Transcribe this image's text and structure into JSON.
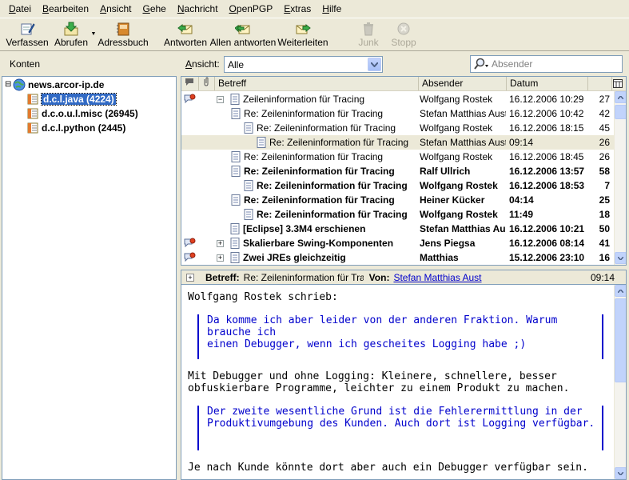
{
  "menu": [
    "Datei",
    "Bearbeiten",
    "Ansicht",
    "Gehe",
    "Nachricht",
    "OpenPGP",
    "Extras",
    "Hilfe"
  ],
  "toolbar": {
    "compose": "Verfassen",
    "fetch": "Abrufen",
    "addressbook": "Adressbuch",
    "reply": "Antworten",
    "replyall": "Allen antworten",
    "forward": "Weiterleiten",
    "junk": "Junk",
    "stop": "Stopp"
  },
  "viewbar": {
    "accounts_label": "Konten",
    "view_label": "Ansicht:",
    "view_value": "Alle",
    "search_placeholder": "Absender"
  },
  "folders": [
    {
      "name": "news.arcor-ip.de",
      "icon": "server-globe-icon",
      "selected": false
    },
    {
      "name": "d.c.l.java (4224)",
      "icon": "newsgroup-icon",
      "selected": true
    },
    {
      "name": "d.c.o.u.l.misc (26945)",
      "icon": "newsgroup-icon",
      "selected": false
    },
    {
      "name": "d.c.l.python (2445)",
      "icon": "newsgroup-icon",
      "selected": false
    }
  ],
  "thread_columns": {
    "subject": "Betreff",
    "sender": "Absender",
    "date": "Datum"
  },
  "threads": [
    {
      "subject": "Zeileninformation für Tracing",
      "sender": "Wolfgang Rostek",
      "date": "16.12.2006 10:29",
      "count": "27",
      "level": 0,
      "expander": "−",
      "unread": false,
      "flag": true
    },
    {
      "subject": "Re: Zeileninformation für Tracing",
      "sender": "Stefan Matthias Aust",
      "date": "16.12.2006 10:42",
      "count": "42",
      "level": 1,
      "expander": "",
      "unread": false,
      "flag": false
    },
    {
      "subject": "Re: Zeileninformation für Tracing",
      "sender": "Wolfgang Rostek",
      "date": "16.12.2006 18:15",
      "count": "45",
      "level": 2,
      "expander": "",
      "unread": false,
      "flag": false
    },
    {
      "subject": "Re: Zeileninformation für Tracing",
      "sender": "Stefan Matthias Aust",
      "date": "09:14",
      "count": "26",
      "level": 3,
      "expander": "",
      "unread": false,
      "flag": false,
      "current": true
    },
    {
      "subject": "Re: Zeileninformation für Tracing",
      "sender": "Wolfgang Rostek",
      "date": "16.12.2006 18:45",
      "count": "26",
      "level": 1,
      "expander": "",
      "unread": false,
      "flag": false
    },
    {
      "subject": "Re: Zeileninformation für Tracing",
      "sender": "Ralf Ullrich",
      "date": "16.12.2006 13:57",
      "count": "58",
      "level": 1,
      "expander": "",
      "unread": true,
      "flag": false
    },
    {
      "subject": "Re: Zeileninformation für Tracing",
      "sender": "Wolfgang Rostek",
      "date": "16.12.2006 18:53",
      "count": "7",
      "level": 2,
      "expander": "",
      "unread": true,
      "flag": false
    },
    {
      "subject": "Re: Zeileninformation für Tracing",
      "sender": "Heiner Kücker",
      "date": "04:14",
      "count": "25",
      "level": 1,
      "expander": "",
      "unread": true,
      "flag": false
    },
    {
      "subject": "Re: Zeileninformation für Tracing",
      "sender": "Wolfgang Rostek",
      "date": "11:49",
      "count": "18",
      "level": 2,
      "expander": "",
      "unread": true,
      "flag": false
    },
    {
      "subject": "[Eclipse] 3.3M4 erschienen",
      "sender": "Stefan Matthias Aust",
      "date": "16.12.2006 10:21",
      "count": "50",
      "level": 0,
      "expander": "",
      "unread": true,
      "flag": false
    },
    {
      "subject": "Skalierbare Swing-Komponenten",
      "sender": "Jens Piegsa",
      "date": "16.12.2006 08:14",
      "count": "41",
      "level": 0,
      "expander": "+",
      "unread": true,
      "flag": true
    },
    {
      "subject": "Zwei JREs gleichzeitig",
      "sender": "Matthias",
      "date": "15.12.2006 23:10",
      "count": "16",
      "level": 0,
      "expander": "+",
      "unread": true,
      "flag": true
    }
  ],
  "message_header": {
    "subject_label": "Betreff:",
    "subject_value": "Re: Zeileninformation für Tracir",
    "from_label": "Von:",
    "from_value": "Stefan Matthias Aust",
    "time": "09:14"
  },
  "message_body": {
    "attribution": "Wolfgang Rostek schrieb:",
    "quote1": "Da komme ich aber leider von der anderen Fraktion. Warum\nbrauche ich\neinen Debugger, wenn ich gescheites Logging habe ;)",
    "para1": "Mit Debugger und ohne Logging: Kleinere, schnellere, besser\nobfuskierbare Programme, leichter zu einem Produkt zu machen.",
    "quote2": "Der zweite wesentliche Grund ist die Fehlerermittlung in der\nProduktivumgebung des Kunden. Auch dort ist Logging verfügbar.",
    "para2": "Je nach Kunde könnte dort aber auch ein Debugger verfügbar sein."
  },
  "colors": {
    "selection": "#316ac5",
    "quote": "#0000cc",
    "chrome": "#ece9d8"
  }
}
